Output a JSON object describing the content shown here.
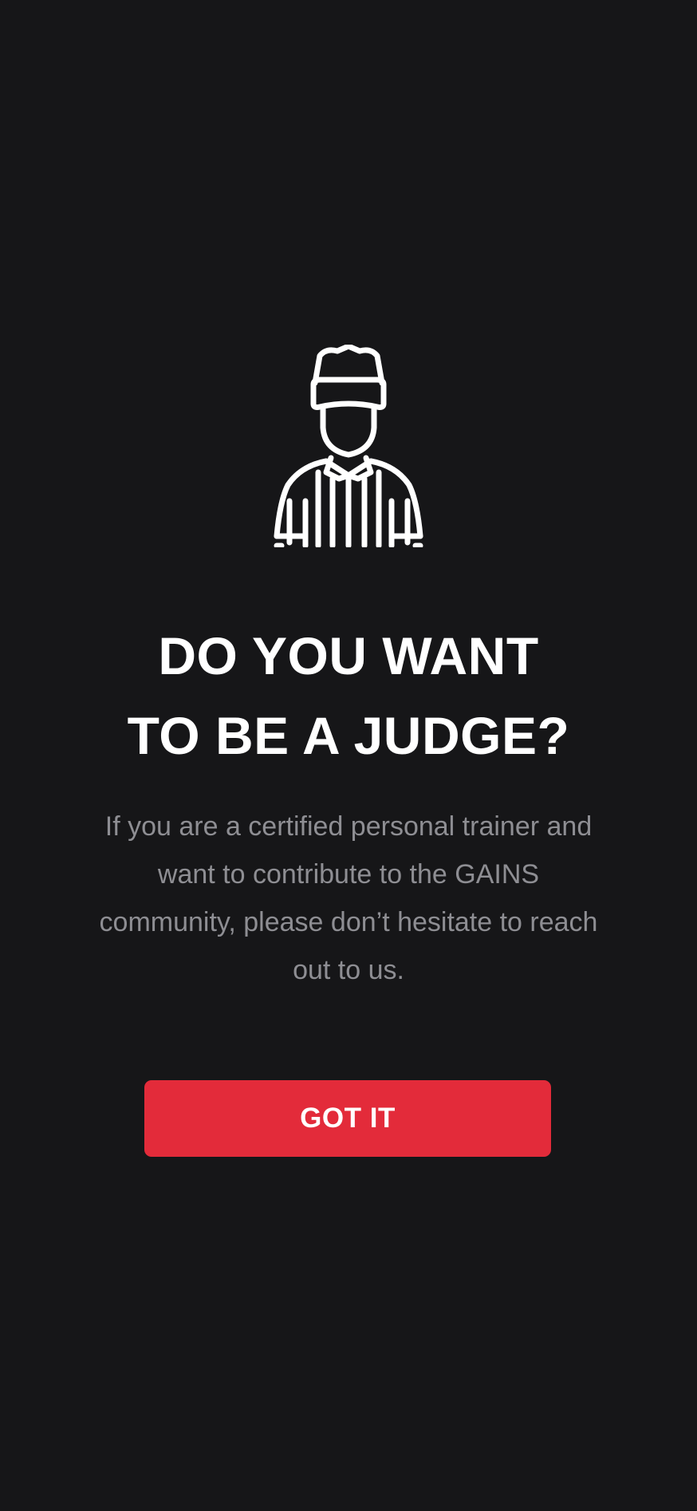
{
  "colors": {
    "background": "#161618",
    "accent": "#e32b3a",
    "title": "#ffffff",
    "description": "#8e8e93"
  },
  "illustration": {
    "icon": "referee-icon"
  },
  "title": {
    "line1": "DO YOU WANT",
    "line2": "TO BE A JUDGE?"
  },
  "description": "If you are a certified personal trainer and want to contribute to the GAINS community, please don’t hesitate to reach out to us.",
  "button": {
    "label": "GOT IT"
  }
}
